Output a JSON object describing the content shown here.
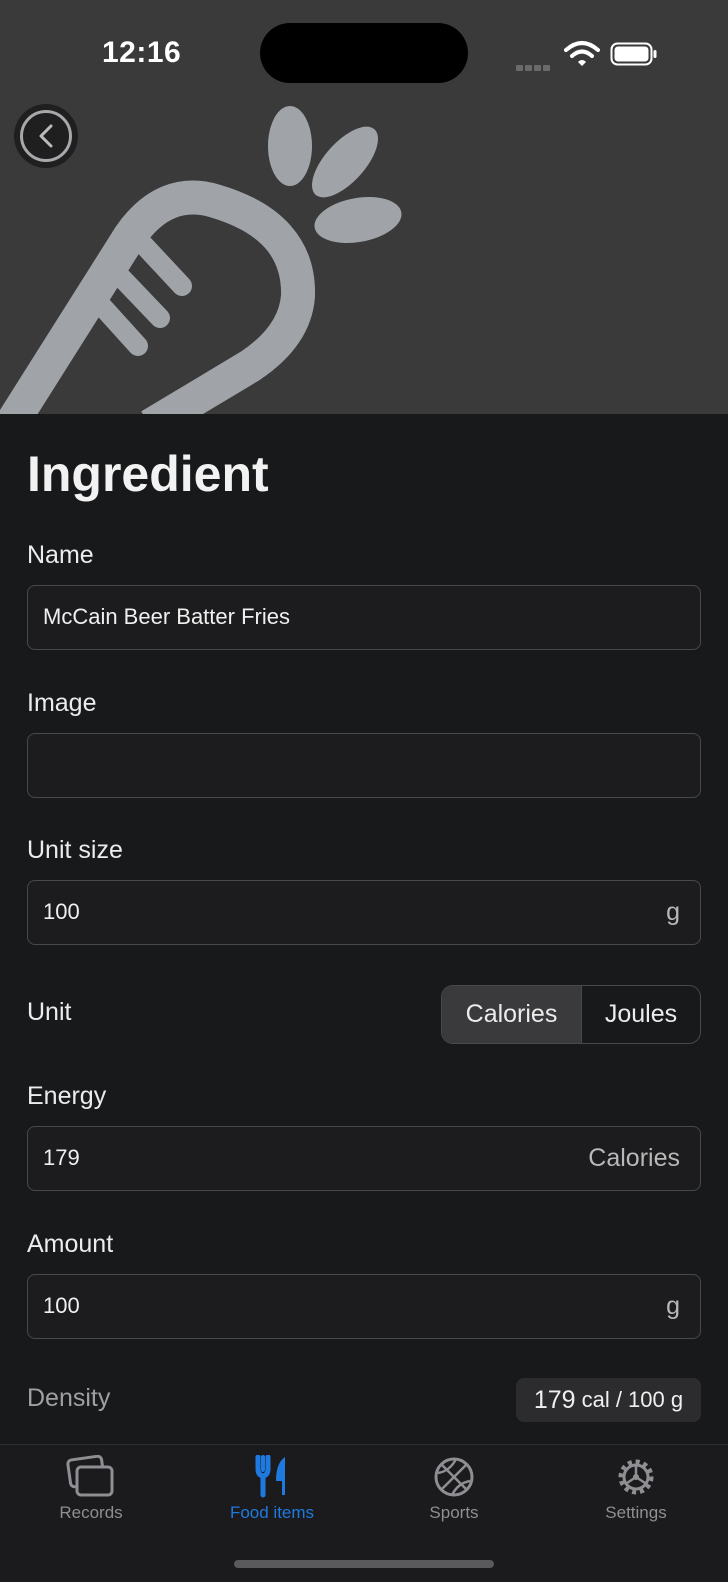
{
  "status_bar": {
    "time": "12:16"
  },
  "page": {
    "title": "Ingredient"
  },
  "form": {
    "name": {
      "label": "Name",
      "value": "McCain Beer Batter Fries"
    },
    "image": {
      "label": "Image",
      "value": ""
    },
    "unit_size": {
      "label": "Unit size",
      "value": "100",
      "unit": "g"
    },
    "unit": {
      "label": "Unit",
      "options": [
        "Calories",
        "Joules"
      ],
      "selected": "Calories"
    },
    "energy": {
      "label": "Energy",
      "value": "179",
      "unit": "Calories"
    },
    "amount": {
      "label": "Amount",
      "value": "100",
      "unit": "g"
    },
    "density": {
      "label": "Density",
      "value": "179",
      "unit": "cal / 100 g"
    }
  },
  "tabbar": {
    "items": [
      {
        "label": "Records",
        "icon": "records-icon"
      },
      {
        "label": "Food items",
        "icon": "fork-knife-icon",
        "active": true
      },
      {
        "label": "Sports",
        "icon": "basketball-icon"
      },
      {
        "label": "Settings",
        "icon": "gear-icon"
      }
    ]
  },
  "colors": {
    "accent": "#1f7ae0",
    "background": "#18191b",
    "hero": "#3a3a3b"
  }
}
